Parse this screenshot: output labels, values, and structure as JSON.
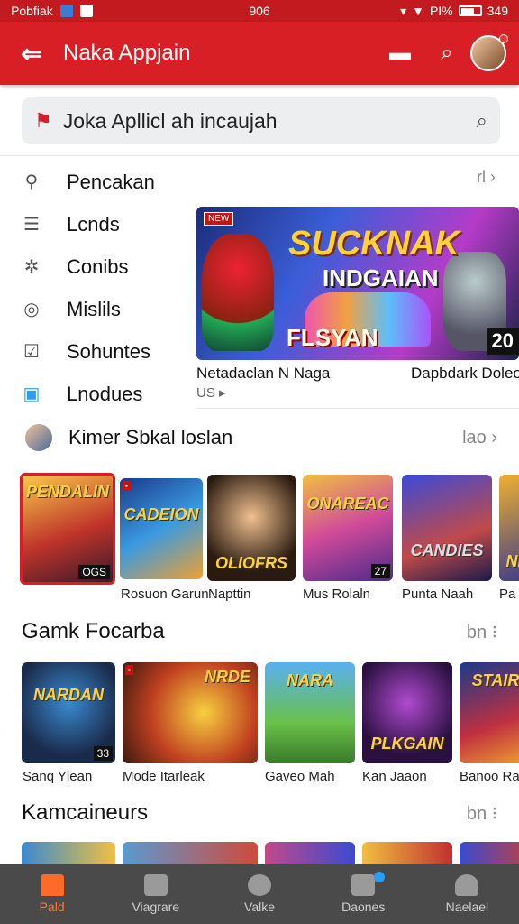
{
  "status": {
    "carrier": "Pobfiak",
    "time": "906",
    "battery_text": "PI%",
    "clock": "349"
  },
  "appbar": {
    "title": "Naka Appjain"
  },
  "search": {
    "text": "Joka Apllicl ah incaujah"
  },
  "menu": [
    {
      "label": "Pencakan",
      "icon": "person-icon"
    },
    {
      "label": "Lcnds",
      "icon": "list-icon"
    },
    {
      "label": "Conibs",
      "icon": "puzzle-icon"
    },
    {
      "label": "Mislils",
      "icon": "camera-icon"
    },
    {
      "label": "Sohuntes",
      "icon": "chart-icon"
    },
    {
      "label": "Lnodues",
      "icon": "apps-icon"
    }
  ],
  "menu_more": "rl",
  "banner": {
    "title": "SUCKNAK",
    "subtitle": "INDGAIAN",
    "name": "FLSYAN",
    "badge": "NEW",
    "number": "20",
    "caption_left": "Netadaclan N Naga",
    "caption_right": "Dapbdark Doleo",
    "sub": "US"
  },
  "section1": {
    "label": "Kimer Sbkal loslan",
    "more": "lao"
  },
  "row1": [
    {
      "title": "PENDALIN",
      "count": "OGS",
      "caption": ""
    },
    {
      "title": "CADEION",
      "caption": "Rosuon Garun"
    },
    {
      "title": "OLIOFRS",
      "caption": "Napttin"
    },
    {
      "title": "ONAREAC",
      "count": "27",
      "caption": "Mus Rolaln"
    },
    {
      "title": "CANDIES",
      "caption": "Punta Naah"
    },
    {
      "title": "NE",
      "caption": "Pa"
    }
  ],
  "section2": {
    "title": "Gamk Focarba",
    "more": "bn"
  },
  "row2": [
    {
      "title": "NARDAN",
      "count": "33",
      "caption": "Sanq Ylean"
    },
    {
      "title": "NRDE",
      "caption": "Mode Itarleak"
    },
    {
      "title": "NARA",
      "caption": "Gaveo Mah"
    },
    {
      "title": "PLKGAIN",
      "caption": "Kan Jaaon"
    },
    {
      "title": "STAIR",
      "caption": "Banoo Rac"
    }
  ],
  "section3": {
    "title": "Kamcaineurs",
    "more": "bn"
  },
  "nav": [
    {
      "label": "Pald",
      "icon": "home-icon",
      "active": true
    },
    {
      "label": "Viagrare",
      "icon": "store-icon"
    },
    {
      "label": "Valke",
      "icon": "compass-icon"
    },
    {
      "label": "Daones",
      "icon": "download-icon",
      "badge": true
    },
    {
      "label": "Naelael",
      "icon": "profile-icon"
    }
  ]
}
